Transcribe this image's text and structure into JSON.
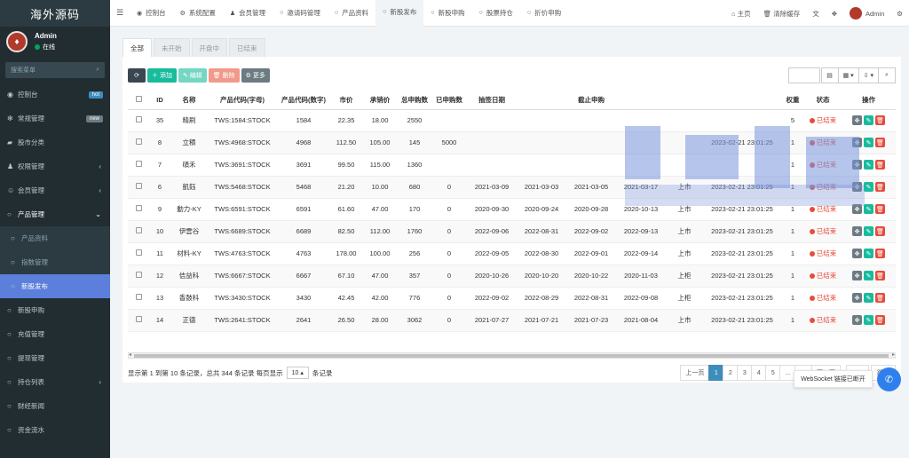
{
  "brand": "海外源码",
  "user": {
    "name": "Admin",
    "status": "在线"
  },
  "sidebar": {
    "search_placeholder": "搜索菜单",
    "items": [
      {
        "label": "控制台",
        "icon": "dashboard-icon",
        "badge": "hot"
      },
      {
        "label": "常规管理",
        "icon": "cogs-icon",
        "badge": "new"
      },
      {
        "label": "股市分类",
        "icon": "category-icon"
      },
      {
        "label": "权限管理",
        "icon": "group-icon",
        "arrow": "‹"
      },
      {
        "label": "会员管理",
        "icon": "user-circle-icon",
        "arrow": "‹"
      },
      {
        "label": "产品管理",
        "icon": "circle-icon",
        "arrow": "⌄"
      }
    ],
    "submenu": [
      "产品资料",
      "指数管理",
      "新股发布"
    ],
    "items_after": [
      "新股申购",
      "充值管理",
      "提现管理",
      "持仓列表",
      "财经新闻",
      "资金流水"
    ],
    "items_after_arrow": {
      "持仓列表": "‹"
    }
  },
  "topbar": {
    "tabs": [
      {
        "label": "控制台",
        "icon": "dashboard-icon"
      },
      {
        "label": "系统配置",
        "icon": "gear-icon"
      },
      {
        "label": "会员管理",
        "icon": "user-icon"
      },
      {
        "label": "邀请码管理",
        "icon": "circle-icon"
      },
      {
        "label": "产品资料",
        "icon": "circle-icon"
      },
      {
        "label": "新股发布",
        "icon": "circle-icon"
      },
      {
        "label": "新股申购",
        "icon": "circle-icon"
      },
      {
        "label": "股票持仓",
        "icon": "circle-icon"
      },
      {
        "label": "折价申购",
        "icon": "circle-icon"
      }
    ],
    "active_tab": 5,
    "home": "主页",
    "clear_cache": "清除缓存",
    "admin": "Admin"
  },
  "status_tabs": [
    "全部",
    "未开始",
    "开盘中",
    "已结束"
  ],
  "toolbar": {
    "add": "添加",
    "edit": "编辑",
    "delete": "删除",
    "more": "更多"
  },
  "table": {
    "headers": [
      "",
      "ID",
      "名称",
      "产品代码(字母)",
      "产品代码(数字)",
      "市价",
      "承销价",
      "总申购数",
      "已申购数",
      "抽签日期",
      "",
      "截止申购",
      "",
      "",
      "",
      "权重",
      "状态",
      "操作"
    ],
    "rows": [
      {
        "id": "35",
        "name": "精刷",
        "code": "TWS:1584:STOCK",
        "num": "1584",
        "market": "22.35",
        "under": "18.00",
        "total": "2550",
        "bought": "",
        "d1": "",
        "d2": "",
        "d3": "",
        "d4": "",
        "listing": "",
        "created": "",
        "weight": "5",
        "status": "已结束"
      },
      {
        "id": "8",
        "name": "立積",
        "code": "TWS:4968:STOCK",
        "num": "4968",
        "market": "112.50",
        "under": "105.00",
        "total": "145",
        "bought": "5000",
        "d1": "",
        "d2": "",
        "d3": "",
        "d4": "",
        "listing": "",
        "created": "2023-02-21 23:01:25",
        "weight": "1",
        "status": "已结束"
      },
      {
        "id": "7",
        "name": "碩禾",
        "code": "TWS:3691:STOCK",
        "num": "3691",
        "market": "99.50",
        "under": "115.00",
        "total": "1360",
        "bought": "",
        "d1": "",
        "d2": "",
        "d3": "",
        "d4": "",
        "listing": "",
        "created": "",
        "weight": "1",
        "status": "已结束"
      },
      {
        "id": "6",
        "name": "凱鈺",
        "code": "TWS:5468:STOCK",
        "num": "5468",
        "market": "21.20",
        "under": "10.00",
        "total": "680",
        "bought": "0",
        "d1": "2021-03-09",
        "d2": "2021-03-03",
        "d3": "2021-03-05",
        "d4": "2021-03-17",
        "listing": "上市",
        "created": "2023-02-21 23:01:25",
        "weight": "1",
        "status": "已结束"
      },
      {
        "id": "9",
        "name": "動力-KY",
        "code": "TWS:6591:STOCK",
        "num": "6591",
        "market": "61.60",
        "under": "47.00",
        "total": "170",
        "bought": "0",
        "d1": "2020-09-30",
        "d2": "2020-09-24",
        "d3": "2020-09-28",
        "d4": "2020-10-13",
        "listing": "上市",
        "created": "2023-02-21 23:01:25",
        "weight": "1",
        "status": "已结束"
      },
      {
        "id": "10",
        "name": "伊雲谷",
        "code": "TWS:6689:STOCK",
        "num": "6689",
        "market": "82.50",
        "under": "112.00",
        "total": "1760",
        "bought": "0",
        "d1": "2022-09-06",
        "d2": "2022-08-31",
        "d3": "2022-09-02",
        "d4": "2022-09-13",
        "listing": "上市",
        "created": "2023-02-21 23:01:25",
        "weight": "1",
        "status": "已结束"
      },
      {
        "id": "11",
        "name": "材料-KY",
        "code": "TWS:4763:STOCK",
        "num": "4763",
        "market": "178.00",
        "under": "100.00",
        "total": "256",
        "bought": "0",
        "d1": "2022-09-05",
        "d2": "2022-08-30",
        "d3": "2022-09-01",
        "d4": "2022-09-14",
        "listing": "上市",
        "created": "2023-02-21 23:01:25",
        "weight": "1",
        "status": "已结束"
      },
      {
        "id": "12",
        "name": "佶益科",
        "code": "TWS:6667:STOCK",
        "num": "6667",
        "market": "67.10",
        "under": "47.00",
        "total": "357",
        "bought": "0",
        "d1": "2020-10-26",
        "d2": "2020-10-20",
        "d3": "2020-10-22",
        "d4": "2020-11-03",
        "listing": "上柜",
        "created": "2023-02-21 23:01:25",
        "weight": "1",
        "status": "已结束"
      },
      {
        "id": "13",
        "name": "香鼓科",
        "code": "TWS:3430:STOCK",
        "num": "3430",
        "market": "42.45",
        "under": "42.00",
        "total": "776",
        "bought": "0",
        "d1": "2022-09-02",
        "d2": "2022-08-29",
        "d3": "2022-08-31",
        "d4": "2022-09-08",
        "listing": "上柜",
        "created": "2023-02-21 23:01:25",
        "weight": "1",
        "status": "已结束"
      },
      {
        "id": "14",
        "name": "正德",
        "code": "TWS:2641:STOCK",
        "num": "2641",
        "market": "26.50",
        "under": "28.00",
        "total": "3062",
        "bought": "0",
        "d1": "2021-07-27",
        "d2": "2021-07-21",
        "d3": "2021-07-23",
        "d4": "2021-08-04",
        "listing": "上市",
        "created": "2023-02-21 23:01:25",
        "weight": "1",
        "status": "已结束"
      }
    ]
  },
  "footer": {
    "summary_pre": "显示第 1 到第 10 条记录，总共 344 条记录 每页显示",
    "page_size": "10 ▴",
    "summary_post": "条记录",
    "pager": [
      "上一页",
      "1",
      "2",
      "3",
      "4",
      "5",
      "...",
      "35",
      "下一页"
    ],
    "go": "跳转"
  },
  "toast": "WebSocket 链接已断开",
  "colors": {
    "sidebar": "#222d32",
    "active_sub": "#5b7fdb",
    "primary": "#3c8dbc",
    "success": "#18bc9c",
    "danger": "#e74c3c"
  }
}
